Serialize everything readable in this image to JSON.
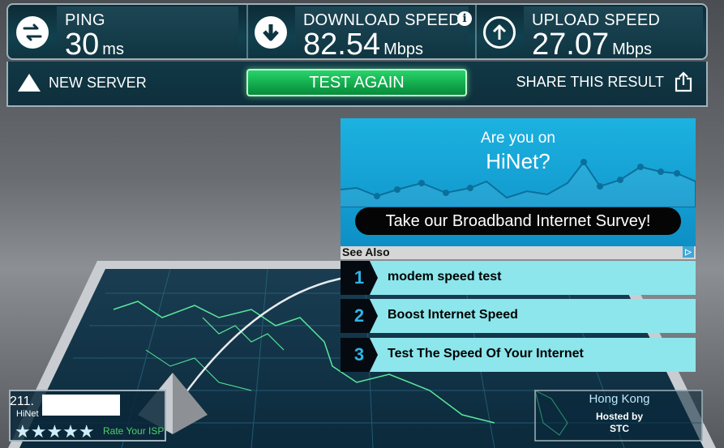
{
  "stats": {
    "ping": {
      "label": "PING",
      "value": "30",
      "unit": "ms"
    },
    "download": {
      "label": "DOWNLOAD SPEED",
      "value": "82.54",
      "unit": "Mbps",
      "info_icon": "i"
    },
    "upload": {
      "label": "UPLOAD SPEED",
      "value": "27.07",
      "unit": "Mbps"
    }
  },
  "actions": {
    "new_server_label": "NEW SERVER",
    "test_again_label": "TEST AGAIN",
    "share_label": "SHARE THIS RESULT"
  },
  "ad": {
    "question_line1": "Are you on",
    "question_line2": "HiNet?",
    "survey_button": "Take our Broadband Internet Survey!"
  },
  "see_also": {
    "title": "See Also",
    "items": [
      {
        "num": "1",
        "text": "modem speed test"
      },
      {
        "num": "2",
        "text": "Boost Internet Speed"
      },
      {
        "num": "3",
        "text": "Test The Speed Of Your Internet"
      }
    ]
  },
  "isp": {
    "ip": "211.",
    "name": "HiNet",
    "stars": "★★★★★",
    "rate_label": "Rate Your ISP"
  },
  "host": {
    "city": "Hong Kong",
    "hosted_by_label": "Hosted by",
    "sponsor": "STC"
  },
  "colors": {
    "accent_green": "#1fc25e",
    "ad_blue": "#1cb2e0",
    "see_also_bg": "#8ce6ec",
    "board_line": "#59e89a"
  },
  "icons": {
    "ping": "arrows-exchange-icon",
    "download": "arrow-down-icon",
    "upload": "arrow-up-icon",
    "new_server": "pyramid-icon",
    "share": "share-icon"
  }
}
